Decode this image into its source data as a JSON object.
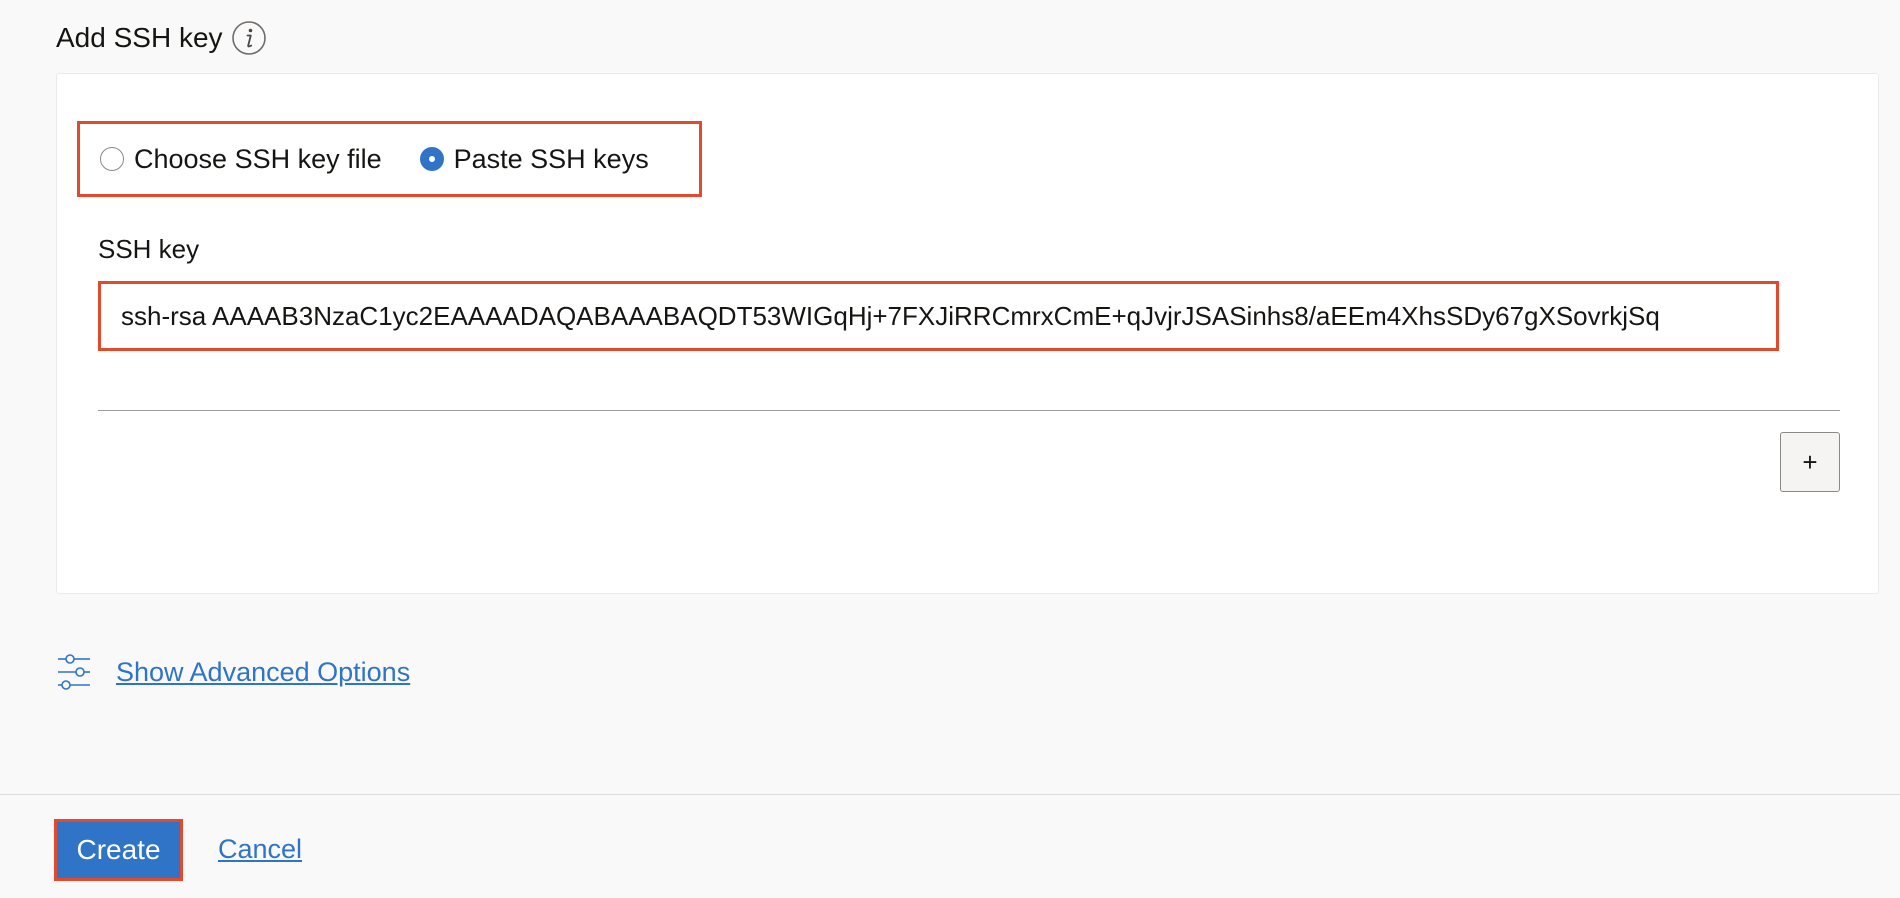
{
  "section": {
    "title": "Add SSH key",
    "info_icon": "info-icon"
  },
  "ssh_source": {
    "options": [
      {
        "label": "Choose SSH key file",
        "checked": false
      },
      {
        "label": "Paste SSH keys",
        "checked": true
      }
    ]
  },
  "ssh_key_field": {
    "label": "SSH key",
    "value": "ssh-rsa AAAAB3NzaC1yc2EAAAADAQABAAABAQDT53WIGqHj+7FXJiRRCmrxCmE+qJvjrJSASinhs8/aEEm4XhsSDy67gXSovrkjSq"
  },
  "add_button": {
    "label": "+"
  },
  "advanced": {
    "label": "Show Advanced Options",
    "icon": "sliders-icon"
  },
  "footer": {
    "create_label": "Create",
    "cancel_label": "Cancel"
  },
  "colors": {
    "accent": "#2f74c7",
    "highlight_border": "#e24a2d",
    "text": "#161513",
    "background": "#f9f9f9"
  }
}
